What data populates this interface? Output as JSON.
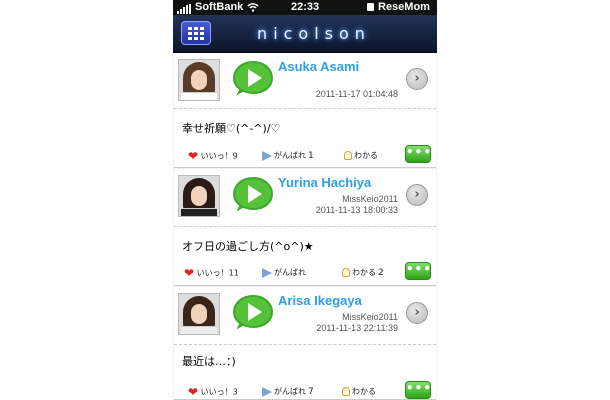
{
  "status_bar": {
    "carrier": "SoftBank",
    "time": "22:33",
    "watermark": "ReseMom"
  },
  "header": {
    "logo": "nicolson",
    "menu_icon": "grid-menu-icon"
  },
  "posts": [
    {
      "name": "Asuka Asami",
      "user": "",
      "date": "2011-11-17 01:04:48",
      "message": "幸せ祈願♡(^-^)/♡",
      "likes_label": "いいっ！9",
      "ganbare_label": "がんばれ",
      "ganbare_count": "1",
      "wakaru_label": "わかる",
      "wakaru_count": ""
    },
    {
      "name": "Yurina Hachiya",
      "user": "MissKeio2011",
      "date": "2011-11-13 18:00:33",
      "message": "オフ日の過ごし方(^o^)★",
      "likes_label": "いいっ！11",
      "ganbare_label": "がんばれ",
      "ganbare_count": "",
      "wakaru_label": "わかる",
      "wakaru_count": "2"
    },
    {
      "name": "Arisa Ikegaya",
      "user": "MissKeio2011",
      "date": "2011-11-13 22:11:39",
      "message": "最近は…：)",
      "likes_label": "いいっ！3",
      "ganbare_label": "がんばれ",
      "ganbare_count": "7",
      "wakaru_label": "わかる",
      "wakaru_count": ""
    }
  ],
  "more_label": "•••",
  "colors": {
    "accent_name": "#2ca0e6",
    "header_bg": "#0c1428",
    "more_button": "#2fa319",
    "heart": "#e52222"
  }
}
